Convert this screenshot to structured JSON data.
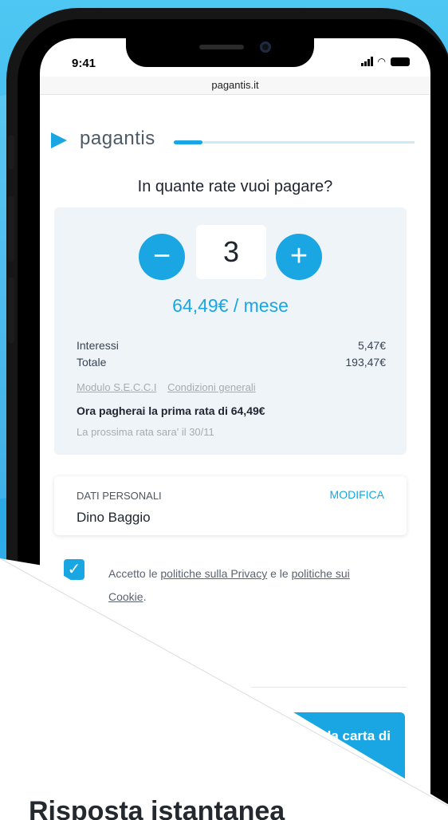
{
  "status": {
    "time": "9:41"
  },
  "browser": {
    "url": "pagantis.it"
  },
  "brand": {
    "name": "pagantis"
  },
  "checkout_progress": 0.12,
  "plan": {
    "question": "In quante rate vuoi pagare?",
    "minus_symbol": "−",
    "plus_symbol": "+",
    "installments": "3",
    "monthly_amount": "64,49€ / mese",
    "interest_label": "Interessi",
    "interest_value": "5,47€",
    "total_label": "Totale",
    "total_value": "193,47€",
    "link_secci": "Modulo S.E.C.C.I",
    "link_conditions": "Condizioni generali",
    "first_rate": "Ora pagherai la prima rata di  64,49€",
    "next_rate": "La prossima rata sara' il 30/11"
  },
  "personal": {
    "section_label": "DATI PERSONALI",
    "edit_label": "MODIFICA",
    "name": "Dino Baggio"
  },
  "consent": {
    "checked": true,
    "text_1": "Accetto le ",
    "privacy_link": "politiche sulla Privacy",
    "text_2": " e le ",
    "cookie_link_1": "politiche sui",
    "cookie_link_2": "Cookie",
    "text_3": "."
  },
  "pay_button": {
    "label": "la carta di"
  },
  "marketing": {
    "headline": "Risposta istantanea"
  },
  "colors": {
    "accent": "#1aa6e2",
    "background": "#35b8ec",
    "card": "#eef4f8"
  }
}
